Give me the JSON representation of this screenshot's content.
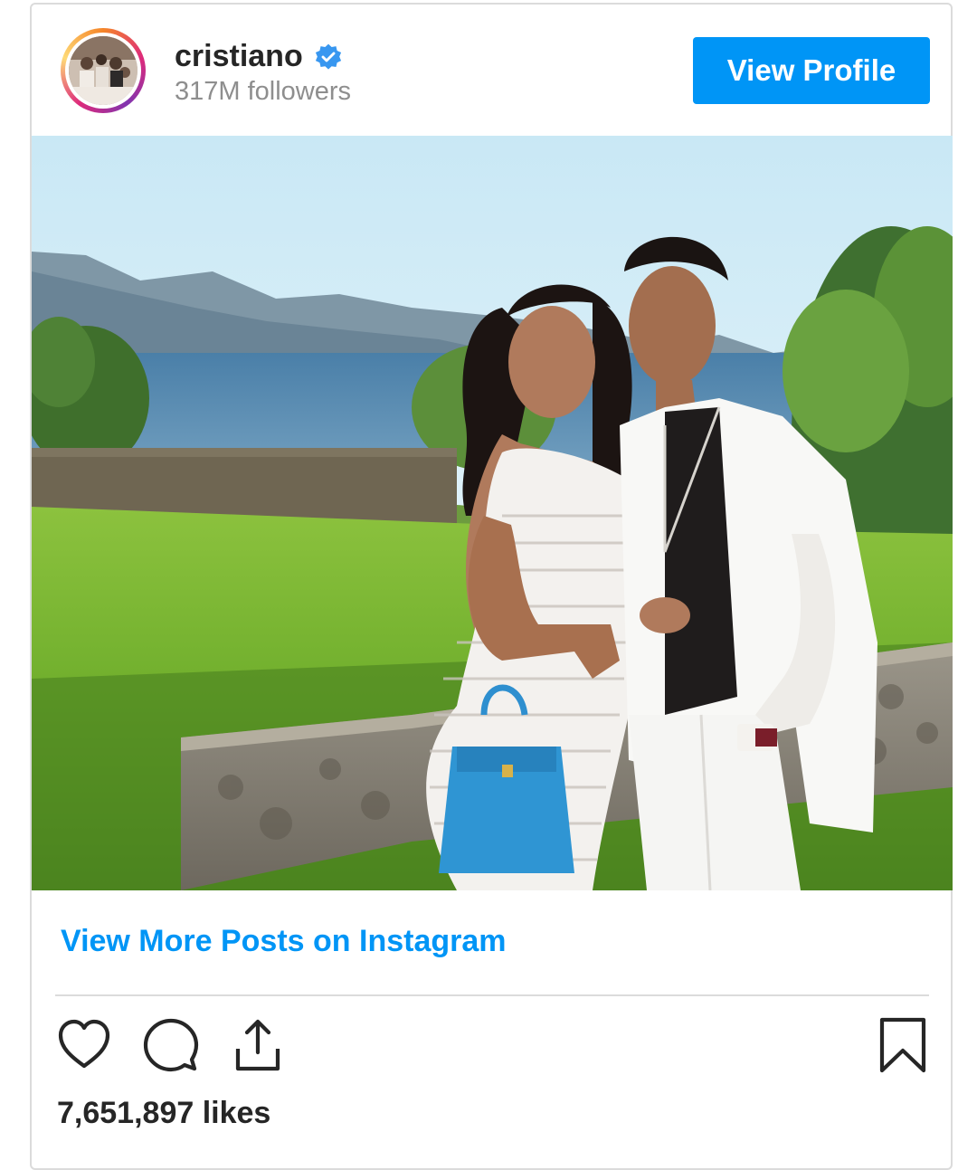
{
  "post": {
    "username": "cristiano",
    "verified_icon": "verified-badge-icon",
    "followers": "317M followers",
    "view_profile_label": "View Profile",
    "view_more_label": "View More Posts on Instagram",
    "likes": "7,651,897 likes"
  },
  "icons": {
    "like": "heart-icon",
    "comment": "comment-icon",
    "share": "share-icon",
    "save": "bookmark-icon"
  },
  "colors": {
    "accent": "#0095f6",
    "text": "#262626",
    "muted": "#8e8e8e",
    "border": "#dbdbdb"
  }
}
